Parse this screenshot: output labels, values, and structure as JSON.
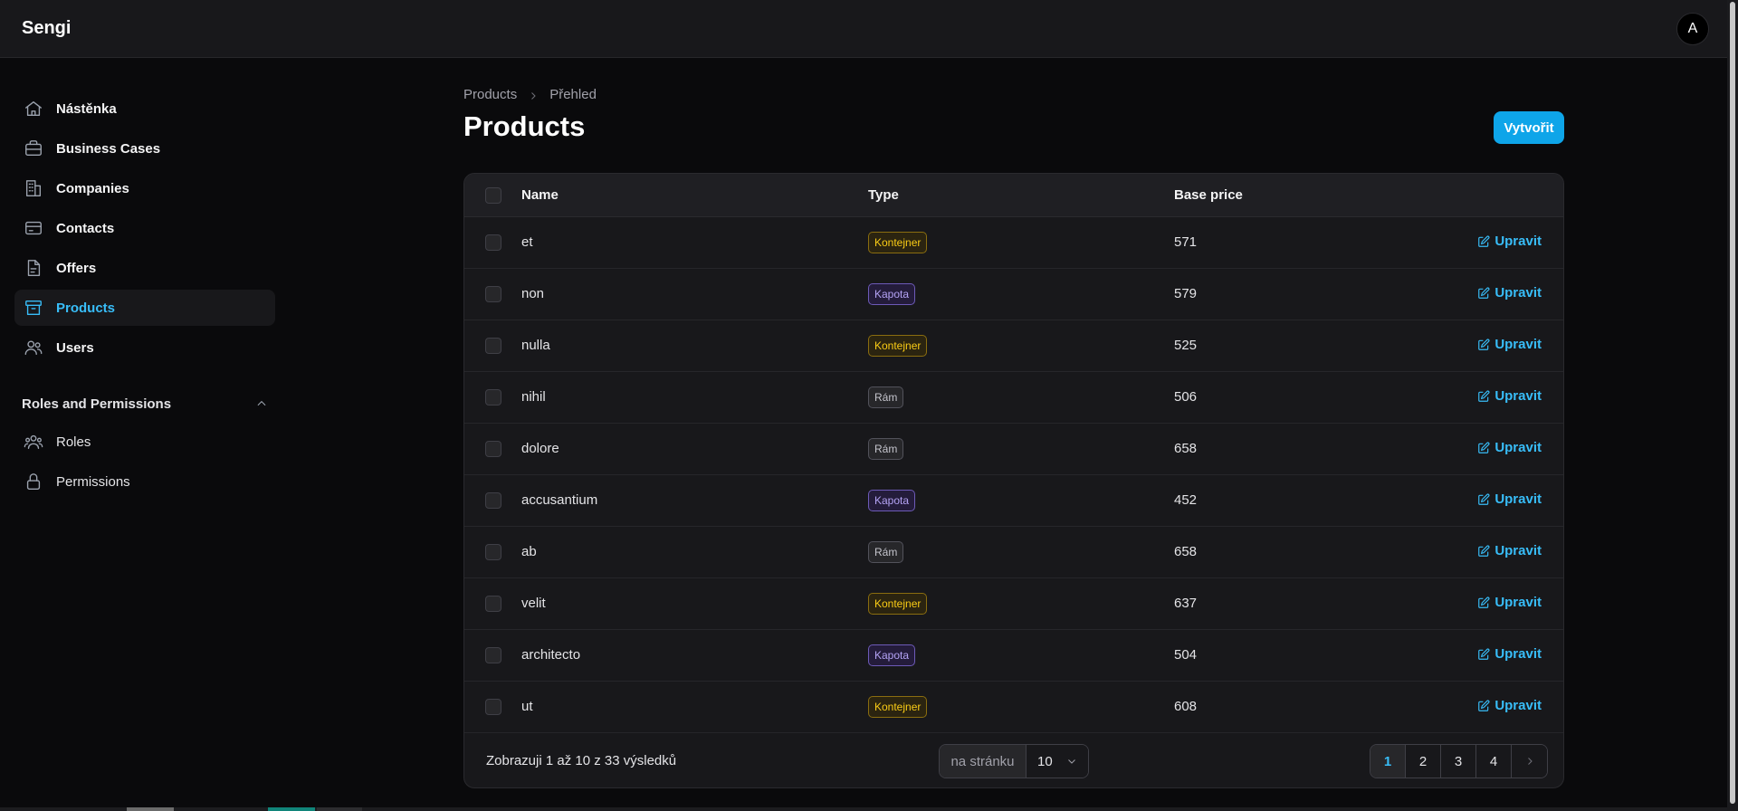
{
  "app": {
    "brand": "Sengi",
    "avatar_initial": "A"
  },
  "sidebar": {
    "items": [
      {
        "label": "Nástěnka",
        "icon": "home-icon"
      },
      {
        "label": "Business Cases",
        "icon": "briefcase-icon"
      },
      {
        "label": "Companies",
        "icon": "building-icon"
      },
      {
        "label": "Contacts",
        "icon": "card-icon"
      },
      {
        "label": "Offers",
        "icon": "document-icon"
      },
      {
        "label": "Products",
        "icon": "archive-icon",
        "active": true
      },
      {
        "label": "Users",
        "icon": "users-icon"
      }
    ],
    "group": {
      "title": "Roles and Permissions",
      "items": [
        {
          "label": "Roles",
          "icon": "user-group-icon"
        },
        {
          "label": "Permissions",
          "icon": "lock-icon"
        }
      ]
    }
  },
  "breadcrumb": {
    "parent": "Products",
    "current": "Přehled"
  },
  "page": {
    "title": "Products",
    "create_label": "Vytvořit"
  },
  "table": {
    "columns": {
      "name": "Name",
      "type": "Type",
      "price": "Base price"
    },
    "edit_label": "Upravit",
    "rows": [
      {
        "name": "et",
        "type": "Kontejner",
        "price": "571"
      },
      {
        "name": "non",
        "type": "Kapota",
        "price": "579"
      },
      {
        "name": "nulla",
        "type": "Kontejner",
        "price": "525"
      },
      {
        "name": "nihil",
        "type": "Rám",
        "price": "506"
      },
      {
        "name": "dolore",
        "type": "Rám",
        "price": "658"
      },
      {
        "name": "accusantium",
        "type": "Kapota",
        "price": "452"
      },
      {
        "name": "ab",
        "type": "Rám",
        "price": "658"
      },
      {
        "name": "velit",
        "type": "Kontejner",
        "price": "637"
      },
      {
        "name": "architecto",
        "type": "Kapota",
        "price": "504"
      },
      {
        "name": "ut",
        "type": "Kontejner",
        "price": "608"
      }
    ]
  },
  "footer": {
    "summary": "Zobrazuji 1 až 10 z 33 výsledků",
    "per_page_label": "na stránku",
    "per_page_value": "10",
    "pages": [
      "1",
      "2",
      "3",
      "4"
    ],
    "current_page": "1"
  },
  "colors": {
    "accent": "#0ea5e9",
    "link": "#38bdf8",
    "kontejner": "#facc15",
    "kapota": "#b4a3f5",
    "ram": "#c4c4cc"
  }
}
